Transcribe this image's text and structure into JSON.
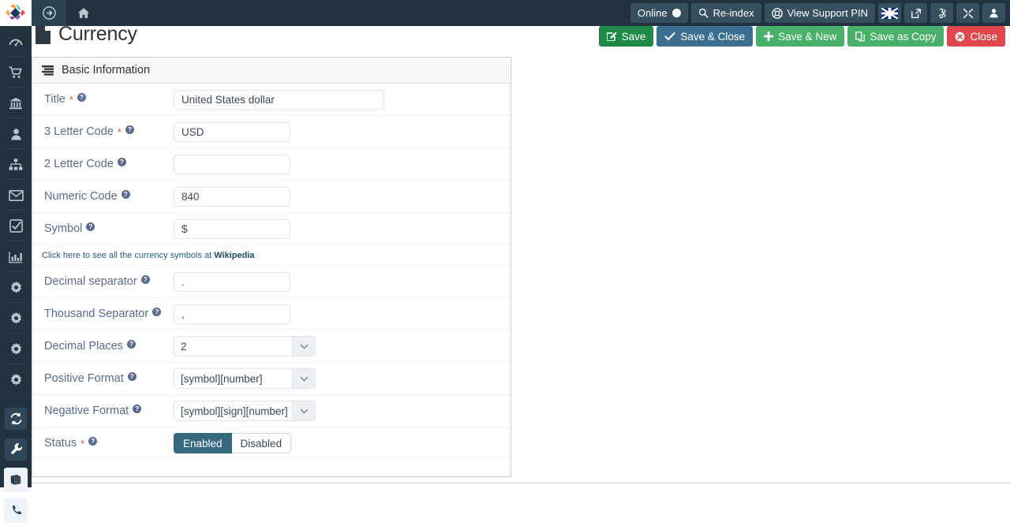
{
  "topbar": {
    "logo_alt": "joomla-logo",
    "forward_icon": "arrow-circle-right-icon",
    "home_icon": "home-icon",
    "online_label": "Online",
    "reindex_label": "Re-index",
    "support_pin_label": "View Support PIN",
    "icons": {
      "search": "search-icon",
      "lifering": "life-ring-icon",
      "flag": "uk-flag-icon",
      "external": "external-link-icon",
      "joomla": "joomla-icon",
      "expand": "expand-arrows-icon",
      "user": "user-icon"
    }
  },
  "sidebar": {
    "items": [
      {
        "icon": "dashboard-gauge-icon",
        "name": "dashboard"
      },
      {
        "icon": "shopping-cart-icon",
        "name": "shop"
      },
      {
        "icon": "bank-icon",
        "name": "bank"
      },
      {
        "icon": "user-icon",
        "name": "customers"
      },
      {
        "icon": "sitemap-icon",
        "name": "sitemap"
      },
      {
        "icon": "envelope-icon",
        "name": "mail"
      },
      {
        "icon": "check-square-icon",
        "name": "tasks"
      },
      {
        "icon": "bar-chart-icon",
        "name": "reports"
      },
      {
        "icon": "gear-icon",
        "name": "settings-1"
      },
      {
        "icon": "gear-icon",
        "name": "settings-2"
      },
      {
        "icon": "gear-icon",
        "name": "settings-3"
      },
      {
        "icon": "gear-icon",
        "name": "settings-4"
      },
      {
        "icon": "refresh-icon",
        "name": "sync"
      },
      {
        "icon": "wrench-icon",
        "name": "tools"
      },
      {
        "icon": "book-icon",
        "name": "catalogue"
      },
      {
        "icon": "phone-icon",
        "name": "phone"
      }
    ]
  },
  "page": {
    "title": "Currency",
    "title_icon": "file-icon"
  },
  "toolbar": {
    "save_label": "Save",
    "save_close_label": "Save & Close",
    "save_new_label": "Save & New",
    "save_copy_label": "Save as Copy",
    "close_label": "Close",
    "icons": {
      "save": "pencil-square-icon",
      "save_close": "check-icon",
      "save_new": "plus-icon",
      "save_copy": "copy-icon",
      "close": "times-circle-icon"
    },
    "colors": {
      "save": "#1f8a45",
      "save_close": "#3c6e8f",
      "save_new": "#49b06a",
      "save_copy": "#49b06a",
      "close": "#e0474c"
    }
  },
  "panel": {
    "heading": "Basic Information",
    "heading_icon": "list-tab-icon"
  },
  "form": {
    "fields": [
      {
        "label": "Title",
        "required": true,
        "value": "United States dollar",
        "type": "text",
        "width": "wide"
      },
      {
        "label": "3 Letter Code",
        "required": true,
        "value": "USD",
        "type": "text",
        "width": "mid"
      },
      {
        "label": "2 Letter Code",
        "required": false,
        "value": "",
        "type": "text",
        "width": "mid"
      },
      {
        "label": "Numeric Code",
        "required": false,
        "value": "840",
        "type": "text",
        "width": "mid"
      },
      {
        "label": "Symbol",
        "required": false,
        "value": "$",
        "type": "text",
        "width": "mid"
      }
    ],
    "wiki_note": {
      "text": "Click here to see all the currency symbols at",
      "link_label": "Wikipedia"
    },
    "fields2": [
      {
        "label": "Decimal separator",
        "required": false,
        "value": ".",
        "type": "text",
        "width": "mid"
      },
      {
        "label": "Thousand Separator",
        "required": false,
        "value": ",",
        "type": "text",
        "width": "mid"
      }
    ],
    "selects": [
      {
        "label": "Decimal Places",
        "required": false,
        "value": "2"
      },
      {
        "label": "Positive Format",
        "required": false,
        "value": "[symbol][number]"
      },
      {
        "label": "Negative Format",
        "required": false,
        "value": "[symbol][sign][number]"
      }
    ],
    "status": {
      "label": "Status",
      "required": true,
      "enabled_label": "Enabled",
      "disabled_label": "Disabled",
      "selected": "Enabled",
      "active_color": "#36687f"
    }
  }
}
